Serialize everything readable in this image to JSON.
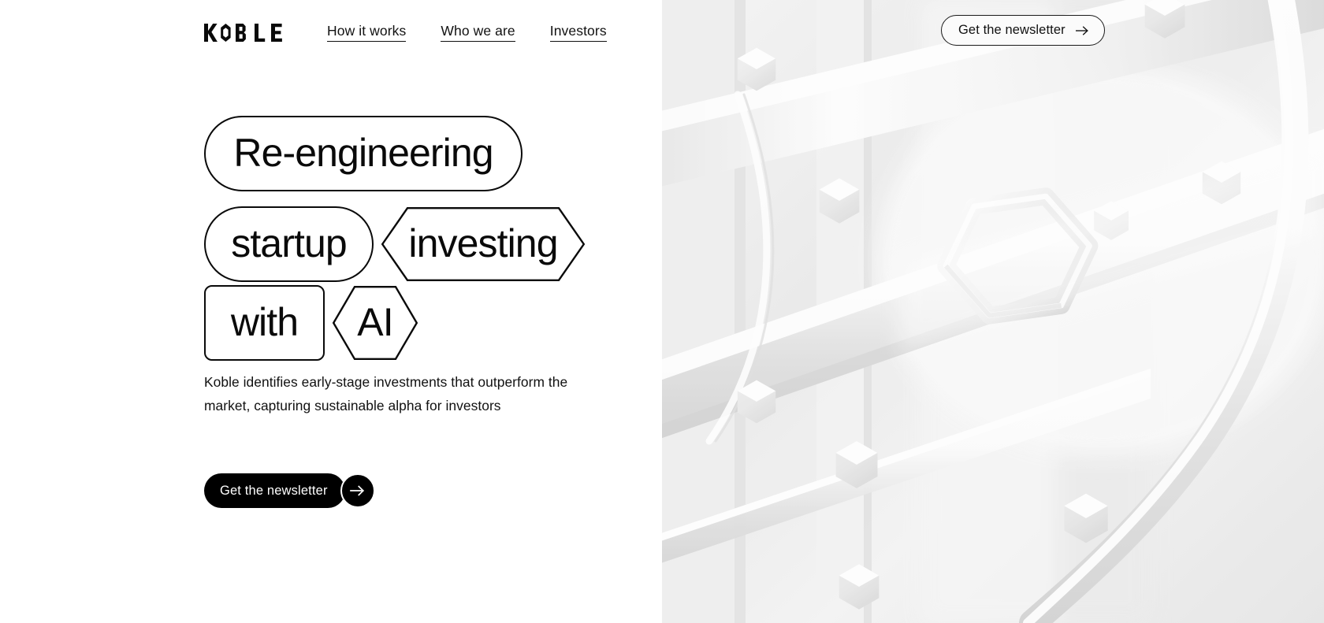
{
  "brand": {
    "name": "KOBLE",
    "letters": [
      "K",
      "O",
      "B",
      "L",
      "E"
    ]
  },
  "nav": {
    "links": [
      {
        "label": "How it works"
      },
      {
        "label": "Who we are"
      },
      {
        "label": "Investors"
      }
    ]
  },
  "header": {
    "cta_label": "Get the newsletter",
    "cta_icon": "arrow-right-icon"
  },
  "hero": {
    "headline_rows": [
      {
        "shapes": [
          {
            "text": "Re-engineering",
            "shape": "stadium"
          }
        ]
      },
      {
        "shapes": [
          {
            "text": "startup",
            "shape": "stadium"
          },
          {
            "text": "investing",
            "shape": "hexagon"
          }
        ]
      },
      {
        "shapes": [
          {
            "text": "with",
            "shape": "rounded-rect"
          },
          {
            "text": "AI",
            "shape": "hexagon"
          }
        ]
      }
    ],
    "paragraph": "Koble identifies early-stage investments that outperform the market, capturing sustainable alpha for investors",
    "cta_label": "Get the newsletter",
    "cta_icon": "arrow-right-icon"
  },
  "colors": {
    "ink": "#0a0a0a",
    "cta_background": "#000000",
    "cta_text": "#ffffff",
    "page_background": "#ffffff",
    "render_background": "#eeeeee"
  },
  "artwork": {
    "name": "abstract-3d-tubes-render",
    "description": "monochrome light-grey 3d render of tubes and hexagonal nodes"
  }
}
